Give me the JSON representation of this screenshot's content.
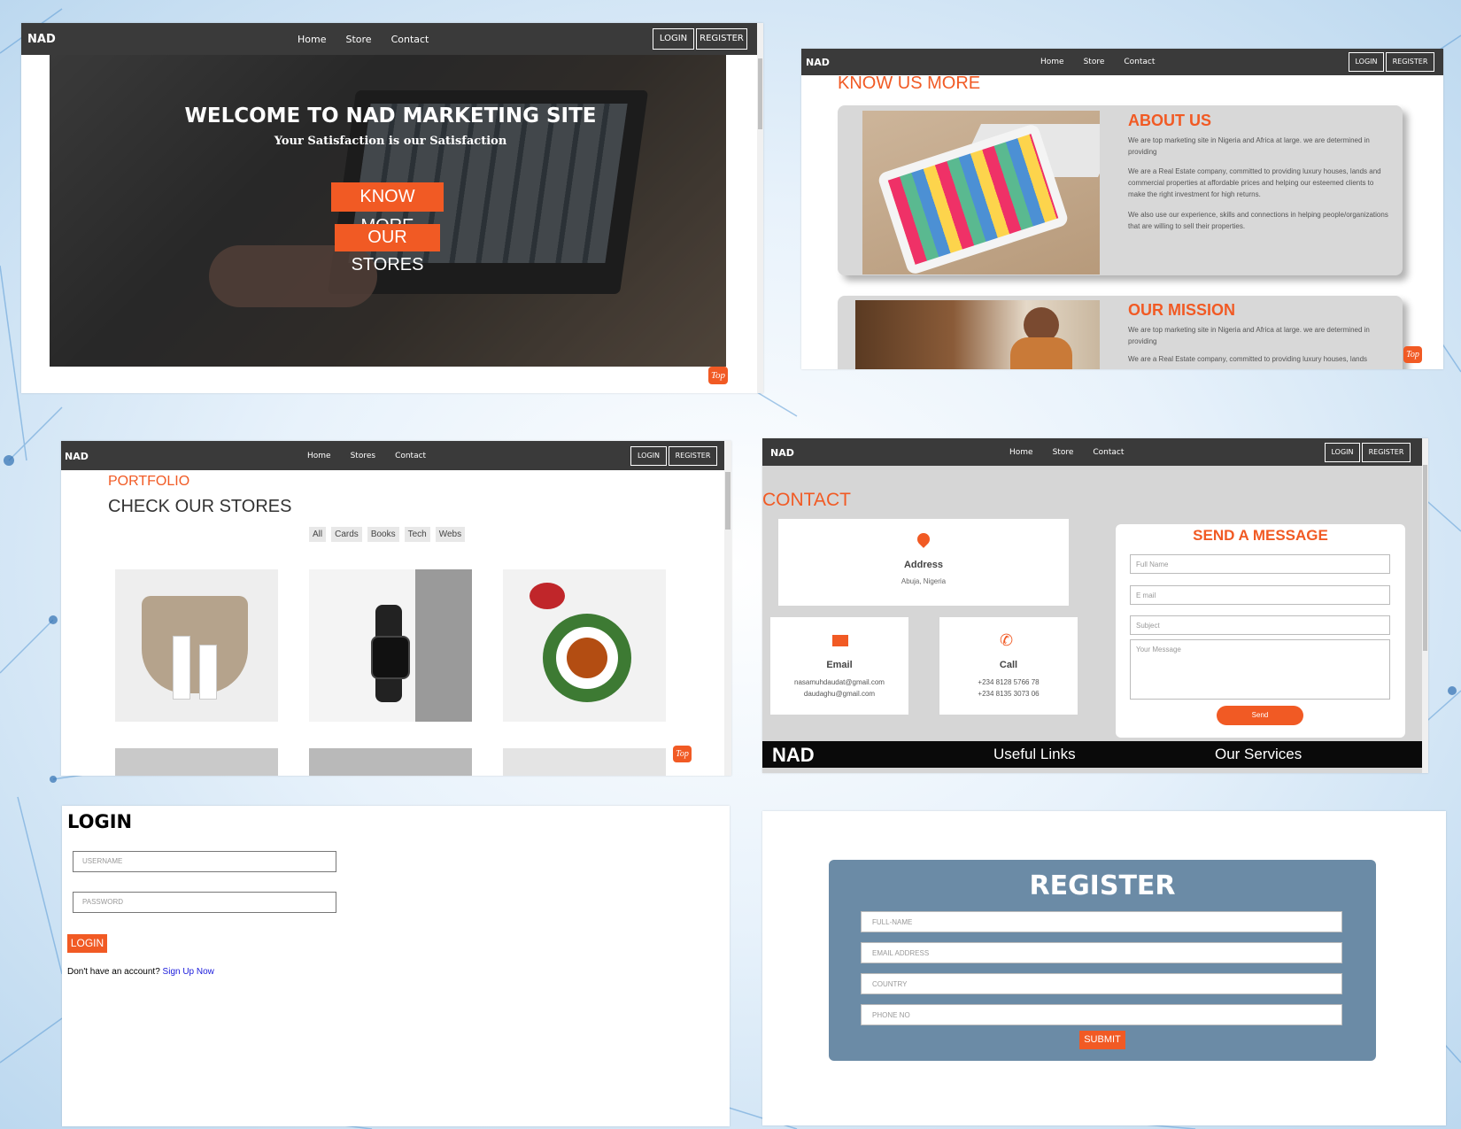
{
  "colors": {
    "accent": "#f15a24",
    "navbar": "#3a3a3a",
    "register_panel": "#6b8ba6"
  },
  "nav": {
    "brand": "NAD",
    "home": "Home",
    "store": "Store",
    "stores": "Stores",
    "contact": "Contact",
    "login": "LOGIN",
    "register": "REGISTER"
  },
  "top_button": "Top",
  "hero": {
    "title": "WELCOME TO NAD MARKETING SITE",
    "subtitle": "Your Satisfaction is our Satisfaction",
    "know_more": "KNOW MORE",
    "our_stores": "OUR STORES"
  },
  "about": {
    "heading": "KNOW US MORE",
    "about_title": "ABOUT US",
    "about_p1": "We are top marketing site in Nigeria and Africa at large. we are determined in providing",
    "about_p2": "We are a Real Estate company, committed to providing luxury houses, lands and commercial properties at affordable prices and helping our esteemed clients to make the right investment for high returns.",
    "about_p3": "We also use our experience, skills and connections in helping people/organizations that are willing to sell their properties.",
    "mission_title": "OUR MISSION",
    "mission_p1": "We are top marketing site in Nigeria and Africa at large. we are determined in providing",
    "mission_p2": "We are a Real Estate company, committed to providing luxury houses, lands"
  },
  "portfolio": {
    "label": "PORTFOLIO",
    "heading": "CHECK OUR STORES",
    "filters": [
      "All",
      "Cards",
      "Books",
      "Tech",
      "Webs"
    ]
  },
  "contact": {
    "heading": "CONTACT",
    "address_label": "Address",
    "address_value": "Abuja, Nigeria",
    "email_label": "Email",
    "email_1": "nasamuhdaudat@gmail.com",
    "email_2": "daudaghu@gmail.com",
    "call_label": "Call",
    "phone_1": "+234 8128 5766 78",
    "phone_2": "+234 8135 3073 06",
    "form_title": "SEND A MESSAGE",
    "name_placeholder": "Full Name",
    "email_placeholder": "E mail",
    "subject_placeholder": "Subject",
    "message_placeholder": "Your Message",
    "send": "Send",
    "footer_brand": "NAD",
    "footer_links": "Useful Links",
    "footer_services": "Our Services"
  },
  "login": {
    "title": "LOGIN",
    "username_placeholder": "USERNAME",
    "password_placeholder": "PASSWORD",
    "button": "LOGIN",
    "no_account": "Don't have an account?",
    "signup": "Sign Up Now"
  },
  "register": {
    "title": "REGISTER",
    "fullname_placeholder": "FULL-NAME",
    "email_placeholder": "EMAIL ADDRESS",
    "country_placeholder": "COUNTRY",
    "phone_placeholder": "PHONE NO",
    "submit": "SUBMIT"
  }
}
